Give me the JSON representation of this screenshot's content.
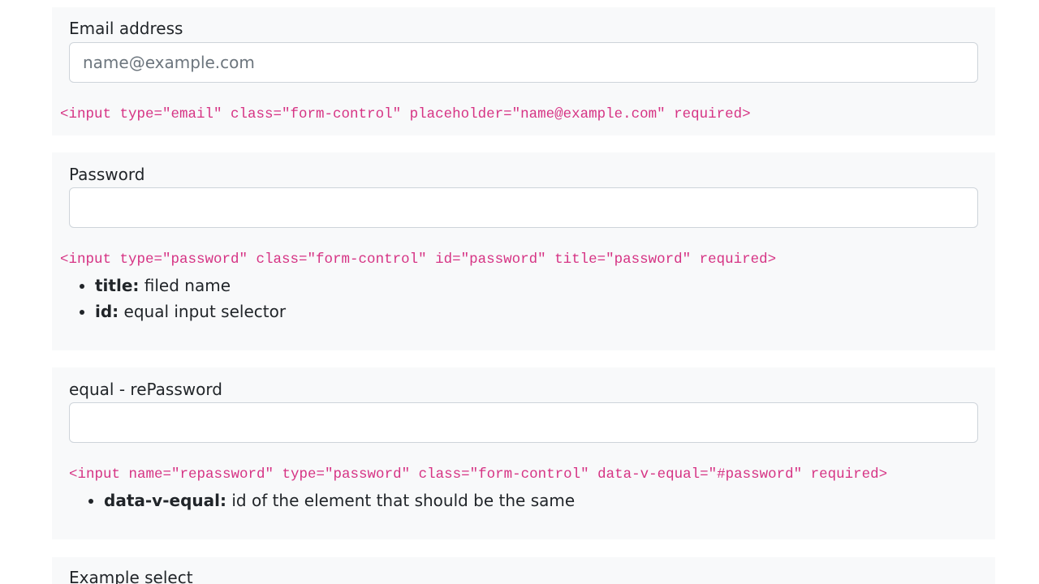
{
  "email_section": {
    "label": "Email address",
    "input_placeholder": "name@example.com",
    "input_value": "",
    "code": "<input type=\"email\" class=\"form-control\" placeholder=\"name@example.com\" required>"
  },
  "password_section": {
    "label": "Password",
    "input_value": "",
    "code": "<input type=\"password\" class=\"form-control\" id=\"password\" title=\"password\" required>",
    "notes": [
      {
        "term": "title:",
        "desc": " filed name"
      },
      {
        "term": "id:",
        "desc": " equal input selector"
      }
    ]
  },
  "repassword_section": {
    "label": "equal - rePassword",
    "input_value": "",
    "code": "<input name=\"repassword\" type=\"password\" class=\"form-control\" data-v-equal=\"#password\" required>",
    "notes": [
      {
        "term": "data-v-equal:",
        "desc": " id of the element that should be the same"
      }
    ]
  },
  "select_section": {
    "label": "Example select"
  },
  "colors": {
    "card_background": "#f8f9fa",
    "code_text": "#d63384",
    "input_border": "#ced4da",
    "placeholder_text": "#6c757d",
    "body_text": "#212529"
  }
}
